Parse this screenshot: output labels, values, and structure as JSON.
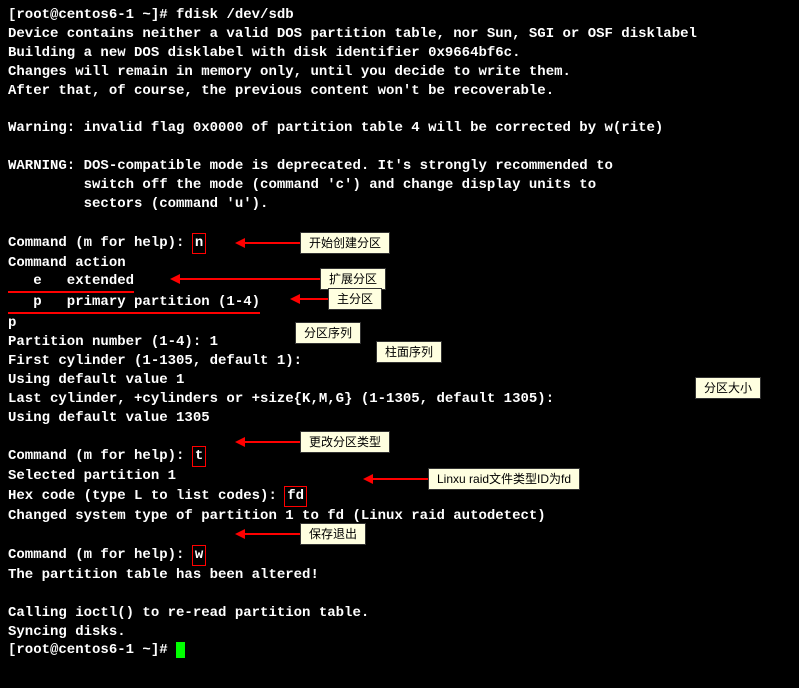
{
  "prompt1": "[root@centos6-1 ~]# ",
  "cmd1": "fdisk /dev/sdb",
  "out": {
    "l1": "Device contains neither a valid DOS partition table, nor Sun, SGI or OSF disklabel",
    "l2": "Building a new DOS disklabel with disk identifier 0x9664bf6c.",
    "l3": "Changes will remain in memory only, until you decide to write them.",
    "l4": "After that, of course, the previous content won't be recoverable.",
    "l5": "Warning: invalid flag 0x0000 of partition table 4 will be corrected by w(rite)",
    "l6": "WARNING: DOS-compatible mode is deprecated. It's strongly recommended to",
    "l7": "         switch off the mode (command 'c') and change display units to",
    "l8": "         sectors (command 'u')."
  },
  "cmd_prompt": "Command (m for help): ",
  "input_n": "n",
  "action_head": "Command action",
  "action_e": "   e   extended",
  "action_p": "   p   primary partition (1-4)",
  "input_p": "p",
  "partnum_prompt": "Partition number (1-4): ",
  "partnum_val": "1",
  "firstcyl": "First cylinder (1-1305, default 1): ",
  "using1": "Using default value 1",
  "lastcyl": "Last cylinder, +cylinders or +size{K,M,G} (1-1305, default 1305): ",
  "using1305": "Using default value 1305",
  "input_t": "t",
  "selected1": "Selected partition 1",
  "hex_prompt": "Hex code (type L to list codes): ",
  "hex_val": "fd",
  "changed": "Changed system type of partition 1 to fd (Linux raid autodetect)",
  "input_w": "w",
  "altered": "The partition table has been altered!",
  "ioctl": "Calling ioctl() to re-read partition table.",
  "sync": "Syncing disks.",
  "prompt2": "[root@centos6-1 ~]# ",
  "annotations": {
    "a1": "开始创建分区",
    "a2": "扩展分区",
    "a3": "主分区",
    "a4": "分区序列",
    "a5": "柱面序列",
    "a6": "分区大小",
    "a7": "更改分区类型",
    "a8": "Linxu raid文件类型ID为fd",
    "a9": "保存退出"
  }
}
